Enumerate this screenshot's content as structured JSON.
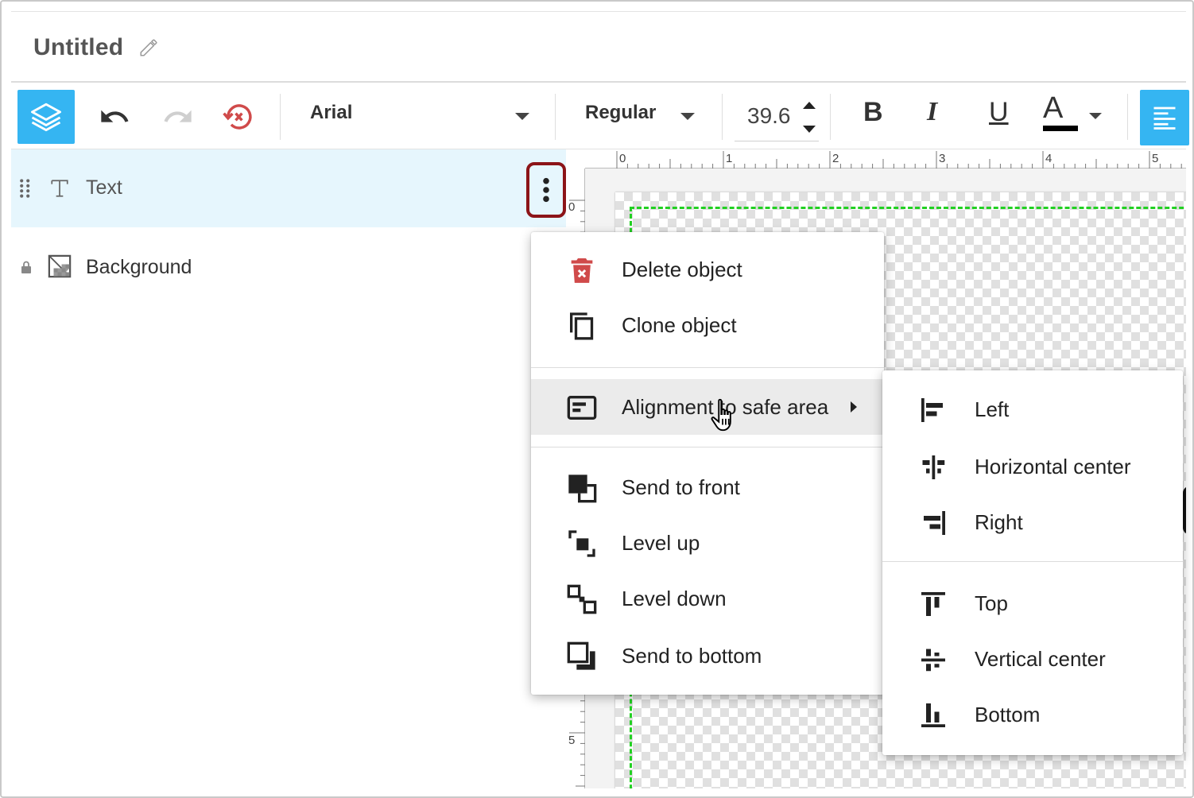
{
  "document": {
    "title": "Untitled"
  },
  "toolbar": {
    "font_family": "Arial",
    "font_weight": "Regular",
    "font_size": "39.6",
    "bold_label": "B",
    "italic_label": "I",
    "underline_label": "U",
    "color_label": "A",
    "text_color": "#000000",
    "accent": "#35b5f2"
  },
  "layers": [
    {
      "name": "Text",
      "icon": "text-type-icon",
      "selected": true
    },
    {
      "name": "Background",
      "icon": "background-image-icon",
      "locked": true
    }
  ],
  "ruler": {
    "top_labels": [
      "0",
      "1",
      "2",
      "3",
      "4",
      "5"
    ],
    "left_labels": [
      "0",
      "5"
    ]
  },
  "context_menu": {
    "items": [
      {
        "label": "Delete object",
        "icon": "trash-icon"
      },
      {
        "label": "Clone object",
        "icon": "copy-icon"
      },
      {
        "label": "Alignment to safe area",
        "icon": "align-box-icon",
        "has_submenu": true
      },
      {
        "label": "Send to front",
        "icon": "send-to-front-icon"
      },
      {
        "label": "Level up",
        "icon": "level-up-icon"
      },
      {
        "label": "Level down",
        "icon": "level-down-icon"
      },
      {
        "label": "Send to bottom",
        "icon": "send-to-bottom-icon"
      }
    ]
  },
  "submenu": {
    "items": [
      {
        "label": "Left",
        "icon": "align-left-icon"
      },
      {
        "label": "Horizontal center",
        "icon": "align-h-center-icon"
      },
      {
        "label": "Right",
        "icon": "align-right-icon"
      },
      {
        "label": "Top",
        "icon": "align-top-icon"
      },
      {
        "label": "Vertical center",
        "icon": "align-v-center-icon"
      },
      {
        "label": "Bottom",
        "icon": "align-bottom-icon"
      }
    ]
  },
  "colors": {
    "delete_icon": "#d04a4a",
    "reset_icon": "#d04a4a",
    "safe_area": "#22d022",
    "highlight_border": "#8c1418"
  }
}
